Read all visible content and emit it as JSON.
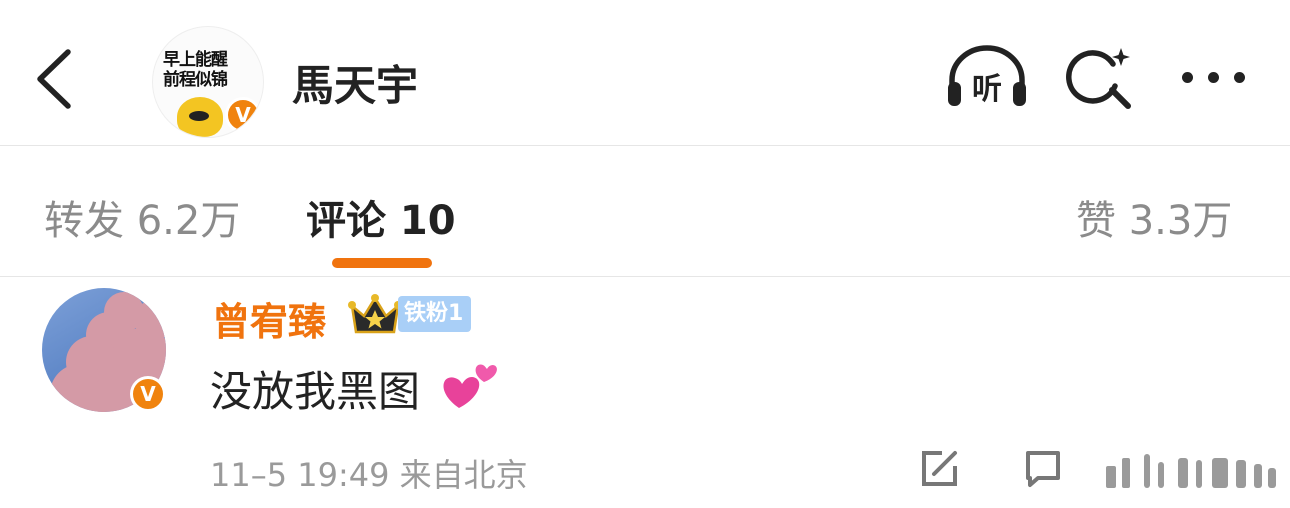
{
  "header": {
    "title": "馬天宇",
    "avatar_text_line1": "早上能醒",
    "avatar_text_line2": "前程似锦",
    "verified_mark": "V",
    "listen_label": "听"
  },
  "tabs": [
    {
      "label": "转发 6.2万"
    },
    {
      "label": "评论 10"
    },
    {
      "label": "赞 3.3万"
    }
  ],
  "comment": {
    "author": "曾宥臻",
    "fan_badge": "铁粉1",
    "verified_mark": "V",
    "text": "没放我黑图",
    "meta": "11–5 19:49  来自北京"
  },
  "colors": {
    "accent": "#f0730e",
    "verified": "#f0830e",
    "fan_badge_bg": "#a9cff7",
    "muted_text": "#8b8b8b"
  },
  "icons": [
    "back-icon",
    "listen-icon",
    "search-icon",
    "more-icon",
    "crown-icon",
    "hearts-icon",
    "share-icon",
    "comment-icon",
    "like-icon"
  ]
}
